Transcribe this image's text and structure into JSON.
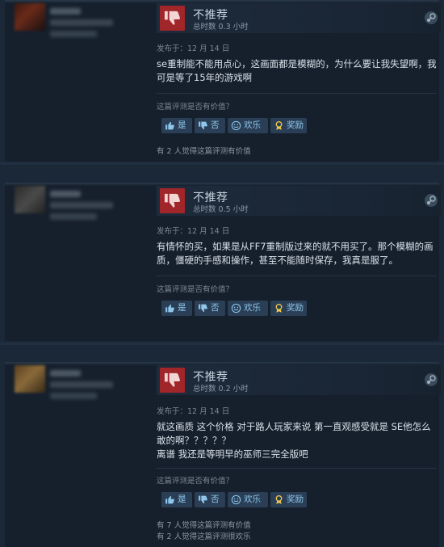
{
  "reviews": [
    {
      "verdict": "不推荐",
      "hours": "总时数 0.3 小时",
      "date": "发布于：12 月 14 日",
      "lines": [
        "se重制能不能用点心，这画面都是模糊的，为什么要让我失望啊，我",
        "可是等了15年的游戏啊"
      ],
      "helpful_prompt": "这篇评测是否有价值？",
      "buttons": {
        "yes": "是",
        "no": "否",
        "funny": "欢乐",
        "award": "奖励"
      },
      "helped": [
        "有 2 人觉得这篇评测有价值"
      ]
    },
    {
      "verdict": "不推荐",
      "hours": "总时数 0.5 小时",
      "date": "发布于：12 月 14 日",
      "lines": [
        "有情怀的买，如果是从FF7重制版过来的就不用买了。那个模糊的画",
        "质，僵硬的手感和操作，甚至不能随时保存，我真是服了。"
      ],
      "helpful_prompt": "这篇评测是否有价值？",
      "buttons": {
        "yes": "是",
        "no": "否",
        "funny": "欢乐",
        "award": "奖励"
      },
      "helped": []
    },
    {
      "verdict": "不推荐",
      "hours": "总时数 0.2 小时",
      "date": "发布于：12 月 14 日",
      "lines": [
        "就这画质 这个价格 对于路人玩家来说 第一直观感受就是 SE他怎么",
        "敢的啊？？？？？",
        "离谱 我还是等明早的巫师三完全版吧"
      ],
      "helpful_prompt": "这篇评测是否有价值？",
      "buttons": {
        "yes": "是",
        "no": "否",
        "funny": "欢乐",
        "award": "奖励"
      },
      "helped": [
        "有 7 人觉得这篇评测有价值",
        "有 2 人觉得这篇评测很欢乐"
      ]
    }
  ],
  "colors": {
    "thumb_bg": "#a0262a",
    "button_bg": "#2a3f56",
    "button_text": "#8fc6ec",
    "page_bg": "#1b2838"
  },
  "icons": {
    "verdict": "thumbs-down-icon",
    "platform": "steam-icon",
    "yes": "thumbs-up-icon",
    "no": "thumbs-down-icon",
    "funny": "smiley-icon",
    "award": "award-icon"
  }
}
